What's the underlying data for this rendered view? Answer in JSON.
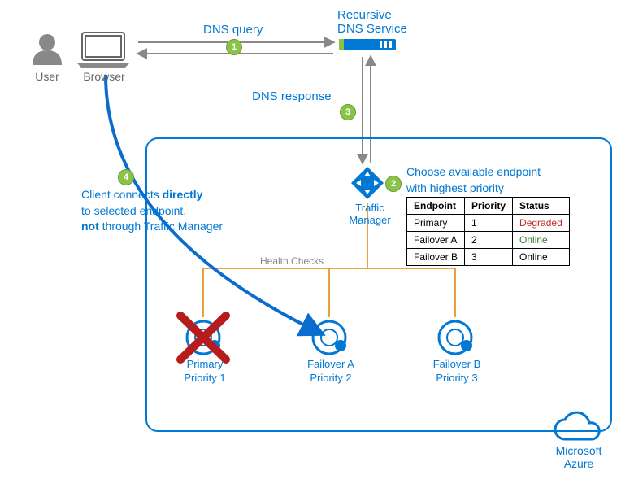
{
  "actors": {
    "user": "User",
    "browser": "Browser",
    "dns": "Recursive\nDNS Service",
    "tm": "Traffic Manager",
    "azure": "Microsoft\nAzure"
  },
  "steps": {
    "s1": "1",
    "s2": "2",
    "s3": "3",
    "s4": "4",
    "query": "DNS query",
    "response": "DNS response"
  },
  "notes": {
    "client_l1": "Client connects ",
    "client_b1": "directly",
    "client_l2": "to selected endpoint,",
    "client_b2": "not",
    "client_l3": " through Traffic Manager",
    "choose_l1": "Choose available endpoint",
    "choose_l2": "with highest priority",
    "health": "Health Checks"
  },
  "endpoints": {
    "primary_l1": "Primary",
    "primary_l2": "Priority 1",
    "foa_l1": "Failover A",
    "foa_l2": "Priority 2",
    "fob_l1": "Failover B",
    "fob_l2": "Priority 3"
  },
  "table": {
    "h_endpoint": "Endpoint",
    "h_priority": "Priority",
    "h_status": "Status",
    "r1_ep": "Primary",
    "r1_pri": "1",
    "r1_st": "Degraded",
    "r2_ep": "Failover A",
    "r2_pri": "2",
    "r2_st": "Online",
    "r3_ep": "Failover B",
    "r3_pri": "3",
    "r3_st": "Online"
  },
  "chart_data": {
    "type": "table",
    "title": "Choose available endpoint with highest priority",
    "columns": [
      "Endpoint",
      "Priority",
      "Status"
    ],
    "rows": [
      {
        "Endpoint": "Primary",
        "Priority": 1,
        "Status": "Degraded"
      },
      {
        "Endpoint": "Failover A",
        "Priority": 2,
        "Status": "Online"
      },
      {
        "Endpoint": "Failover B",
        "Priority": 3,
        "Status": "Online"
      }
    ],
    "flow_steps": [
      {
        "n": 1,
        "label": "DNS query",
        "from": "Browser",
        "to": "Recursive DNS Service"
      },
      {
        "n": 2,
        "label": "Choose available endpoint with highest priority",
        "at": "Traffic Manager"
      },
      {
        "n": 3,
        "label": "DNS response",
        "from": "Recursive DNS Service",
        "to": "Browser"
      },
      {
        "n": 4,
        "label": "Client connects directly to selected endpoint, not through Traffic Manager",
        "from": "Browser",
        "to": "Failover A"
      }
    ]
  }
}
